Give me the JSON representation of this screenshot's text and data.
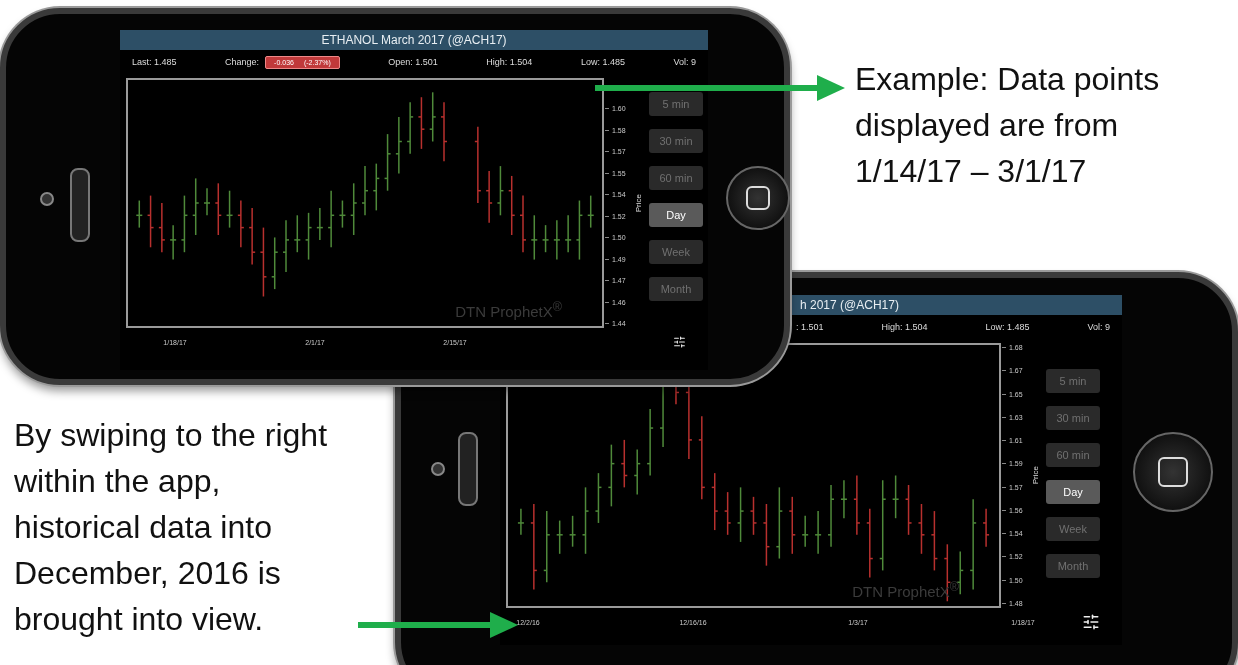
{
  "notes": [
    {
      "text": "Example: Data points displayed are from 1/14/17 – 3/1/17"
    },
    {
      "text": "By swiping to the right within the app, historical data into December, 2016 is brought into view."
    }
  ],
  "phones": [
    {
      "title": "ETHANOL March 2017 (@ACH17)",
      "stats": [
        {
          "kind": "text",
          "text": "Last: 1.485"
        },
        {
          "kind": "change",
          "text": "Change:",
          "value": "-0.036",
          "percent": "(-2.37%)"
        },
        {
          "kind": "text",
          "text": "Open: 1.501"
        },
        {
          "kind": "text",
          "text": "High: 1.504"
        },
        {
          "kind": "text",
          "text": "Low: 1.485"
        },
        {
          "kind": "text",
          "text": "Vol: 9"
        }
      ],
      "yticks": [
        "1.60",
        "1.58",
        "1.57",
        "1.55",
        "1.54",
        "1.52",
        "1.50",
        "1.49",
        "1.47",
        "1.46",
        "1.44"
      ],
      "ylabel": "Price",
      "xticks": [
        "1/18/17",
        "2/1/17",
        "2/15/17"
      ],
      "watermark": "DTN ProphetX$^{®}$",
      "intervals": [
        {
          "label": "5 min",
          "selected": false
        },
        {
          "label": "30 min",
          "selected": false
        },
        {
          "label": "60 min",
          "selected": false
        },
        {
          "label": "Day",
          "selected": true
        },
        {
          "label": "Week",
          "selected": false
        },
        {
          "label": "Month",
          "selected": false
        }
      ]
    },
    {
      "title": "h 2017 (@ACH17)",
      "stats": [
        {
          "kind": "text",
          "text": ": 1.501"
        },
        {
          "kind": "text",
          "text": "High: 1.504"
        },
        {
          "kind": "text",
          "text": "Low: 1.485"
        },
        {
          "kind": "text",
          "text": "Vol: 9"
        }
      ],
      "yticks": [
        "1.68",
        "1.67",
        "1.65",
        "1.63",
        "1.61",
        "1.59",
        "1.57",
        "1.56",
        "1.54",
        "1.52",
        "1.50",
        "1.48"
      ],
      "ylabel": "Price",
      "xticks": [
        "12/2/16",
        "12/16/16",
        "1/3/17",
        "1/18/17"
      ],
      "watermark": "DTN ProphetX$^{®}$",
      "intervals": [
        {
          "label": "5 min",
          "selected": false
        },
        {
          "label": "30 min",
          "selected": false
        },
        {
          "label": "60 min",
          "selected": false
        },
        {
          "label": "Day",
          "selected": true
        },
        {
          "label": "Week",
          "selected": false
        },
        {
          "label": "Month",
          "selected": false
        }
      ]
    }
  ]
}
